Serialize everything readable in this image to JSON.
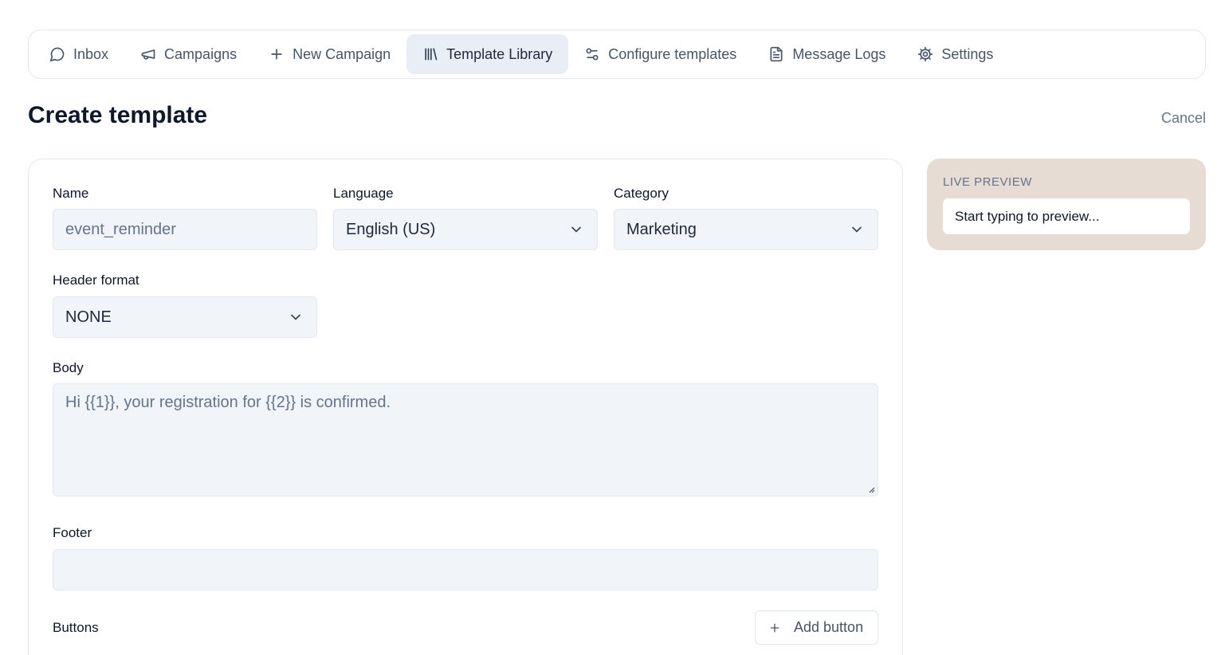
{
  "nav": {
    "items": [
      {
        "label": "Inbox",
        "icon": "chat-bubble-icon",
        "active": false
      },
      {
        "label": "Campaigns",
        "icon": "megaphone-icon",
        "active": false
      },
      {
        "label": "New Campaign",
        "icon": "plus-icon",
        "active": false
      },
      {
        "label": "Template Library",
        "icon": "library-icon",
        "active": true
      },
      {
        "label": "Configure templates",
        "icon": "sliders-icon",
        "active": false
      },
      {
        "label": "Message Logs",
        "icon": "document-icon",
        "active": false
      },
      {
        "label": "Settings",
        "icon": "gear-icon",
        "active": false
      }
    ]
  },
  "page": {
    "title": "Create template",
    "cancel_label": "Cancel"
  },
  "form": {
    "name": {
      "label": "Name",
      "placeholder": "event_reminder",
      "value": ""
    },
    "language": {
      "label": "Language",
      "value": "English (US)"
    },
    "category": {
      "label": "Category",
      "value": "Marketing"
    },
    "header_format": {
      "label": "Header format",
      "value": "NONE"
    },
    "body": {
      "label": "Body",
      "placeholder": "Hi {{1}}, your registration for {{2}} is confirmed.",
      "value": ""
    },
    "footer": {
      "label": "Footer",
      "placeholder": "",
      "value": ""
    },
    "buttons": {
      "label": "Buttons",
      "add_label": "Add button"
    }
  },
  "preview": {
    "title": "LIVE PREVIEW",
    "text": "Start typing to preview..."
  },
  "colors": {
    "active_tab_bg": "#e9edf5",
    "field_bg": "#f1f4f9",
    "preview_bg": "#e6dcd3"
  }
}
